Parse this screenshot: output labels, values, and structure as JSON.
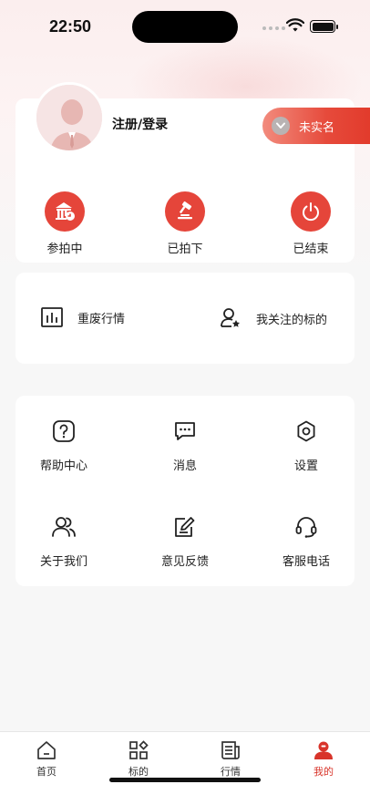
{
  "status_bar": {
    "time": "22:50"
  },
  "profile": {
    "login_label": "注册/登录",
    "verify_badge": "未实名"
  },
  "auction_status": [
    {
      "label": "参拍中",
      "icon": "auction-building-icon"
    },
    {
      "label": "已拍下",
      "icon": "gavel-icon"
    },
    {
      "label": "已结束",
      "icon": "power-icon"
    }
  ],
  "quick_links": [
    {
      "label": "重废行情",
      "icon": "bar-chart-icon"
    },
    {
      "label": "我关注的标的",
      "icon": "user-star-icon"
    }
  ],
  "menu": [
    {
      "label": "帮助中心",
      "icon": "help-icon"
    },
    {
      "label": "消息",
      "icon": "message-icon"
    },
    {
      "label": "设置",
      "icon": "gear-icon"
    },
    {
      "label": "关于我们",
      "icon": "users-icon"
    },
    {
      "label": "意见反馈",
      "icon": "feedback-icon"
    },
    {
      "label": "客服电话",
      "icon": "headset-icon"
    }
  ],
  "tabbar": [
    {
      "label": "首页",
      "icon": "home-icon",
      "active": false
    },
    {
      "label": "标的",
      "icon": "grid-icon",
      "active": false
    },
    {
      "label": "行情",
      "icon": "news-icon",
      "active": false
    },
    {
      "label": "我的",
      "icon": "profile-icon",
      "active": true
    }
  ],
  "colors": {
    "accent": "#e5453a",
    "active_tab": "#d8342a"
  }
}
